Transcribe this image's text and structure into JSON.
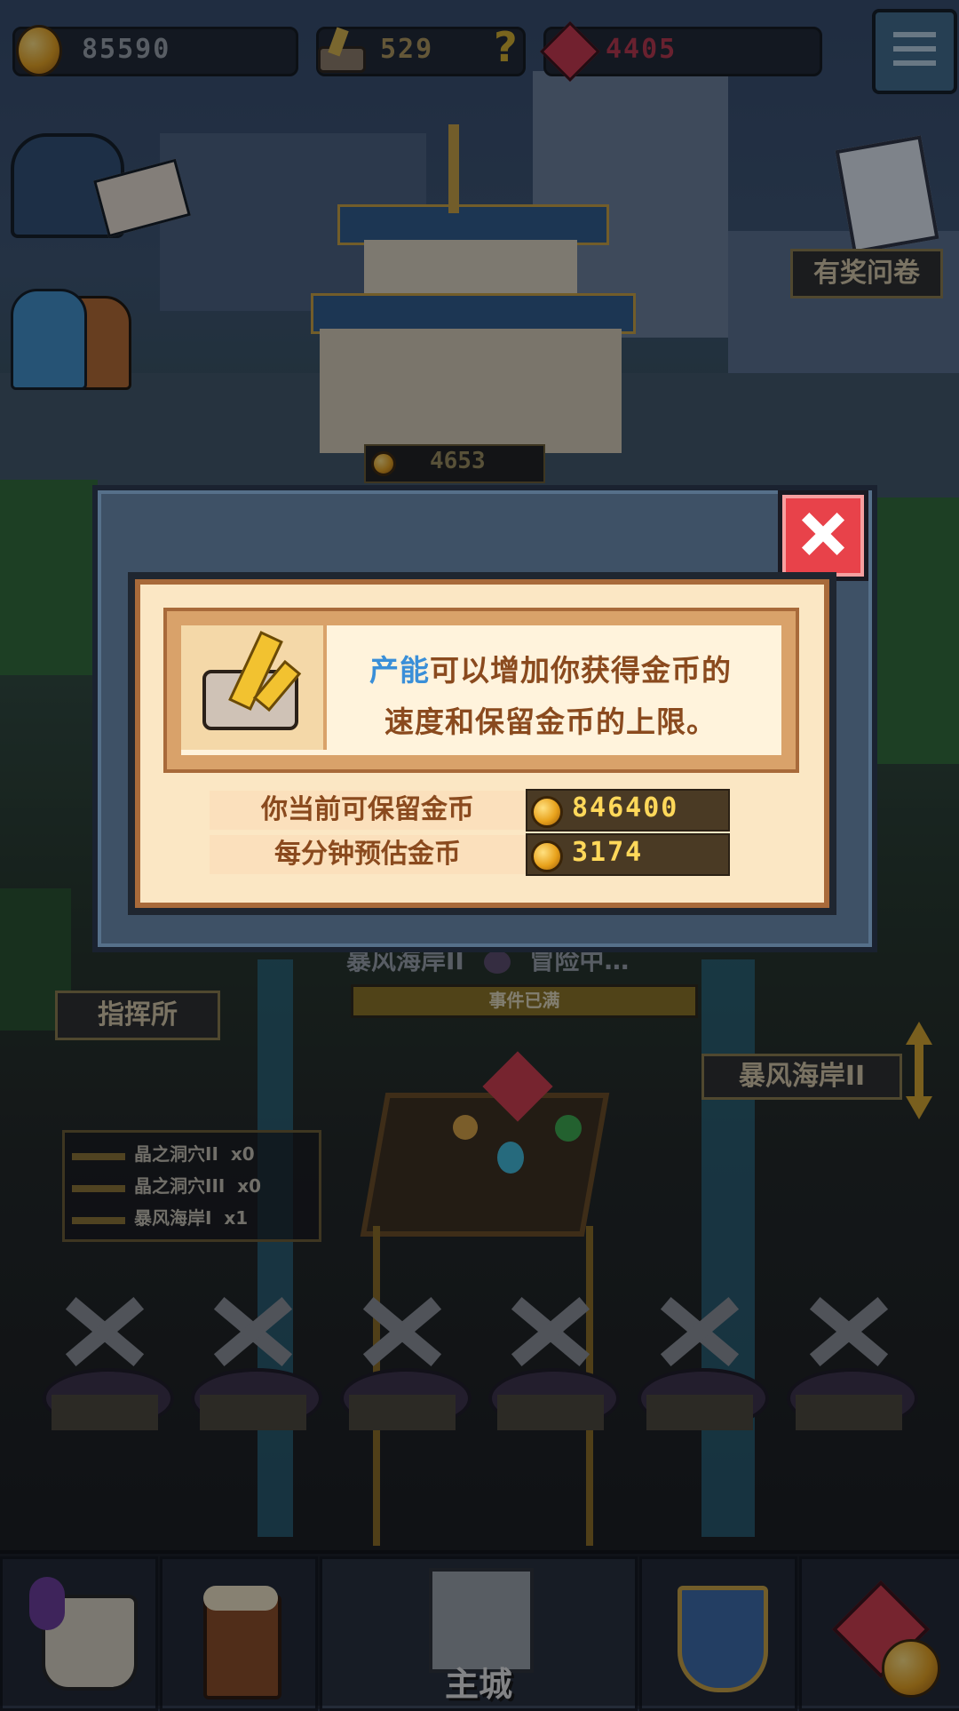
{
  "resources": {
    "gold": "85590",
    "ore": "529",
    "gems": "4405",
    "help": "?"
  },
  "side_buttons": {
    "survey_label": "有奖问卷"
  },
  "background": {
    "building_coin_text": "4653",
    "expedition_title": "暴风海岸II",
    "expedition_status": "冒险中…",
    "expedition_bar_text": "事件已满",
    "command_post_label": "指挥所",
    "region_label": "暴风海岸II",
    "region_list": [
      {
        "name": "晶之洞穴II",
        "count": "x0"
      },
      {
        "name": "晶之洞穴III",
        "count": "x0"
      },
      {
        "name": "暴风海岸I",
        "count": "x1"
      }
    ]
  },
  "dialog": {
    "keyword": "产能",
    "desc_line1_rest": "可以增加你获得金币的",
    "desc_line2": "速度和保留金币的上限。",
    "stats": [
      {
        "label": "你当前可保留金币",
        "value": "846400"
      },
      {
        "label": "每分钟预估金币",
        "value": "3174"
      }
    ],
    "colors": {
      "keyword": "#3a8fd8",
      "text": "#8a4a1e",
      "value": "#ffd85a"
    }
  },
  "nav": {
    "main_city_label": "主城"
  }
}
